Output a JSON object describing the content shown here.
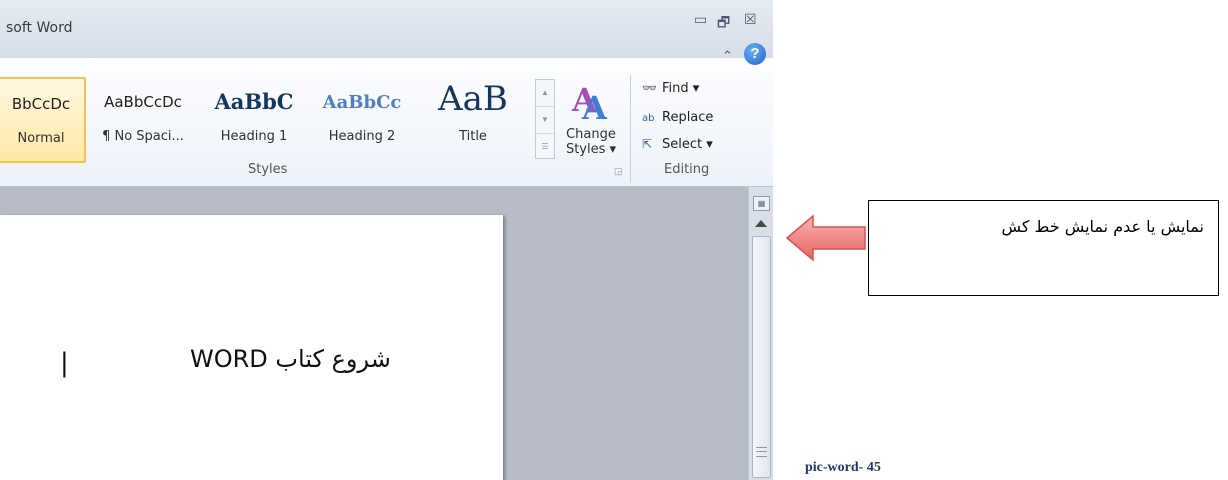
{
  "window": {
    "title": "soft Word",
    "controls": {
      "minimize": "▭",
      "restore": "🗗",
      "close": "☒"
    },
    "minimize_ribbon": "⌃",
    "help": "?"
  },
  "styles_gallery": {
    "items": [
      {
        "preview": "BbCcDc",
        "name": "Normal",
        "selected": true
      },
      {
        "preview": "AaBbCcDc",
        "name": "¶ No Spaci...",
        "selected": false
      },
      {
        "preview": "AaBbC",
        "name": "Heading 1",
        "selected": false
      },
      {
        "preview": "AaBbCc",
        "name": "Heading 2",
        "selected": false
      },
      {
        "preview": "AaB",
        "name": "Title",
        "selected": false
      }
    ],
    "change_styles_label_1": "Change",
    "change_styles_label_2": "Styles ▾",
    "group_label": "Styles"
  },
  "editing": {
    "find": "Find ▾",
    "replace": "Replace",
    "select": "Select ▾",
    "group_label": "Editing"
  },
  "document": {
    "text": "شروع کتاب WORD",
    "cursor": "|"
  },
  "annotation": {
    "callout_text": "نمایش یا عدم نمایش خط کش",
    "caption": "pic-word- 45",
    "arrow_color": "#f08080"
  }
}
